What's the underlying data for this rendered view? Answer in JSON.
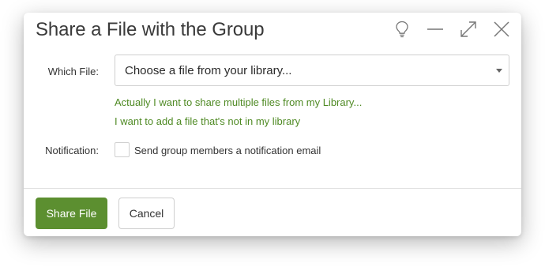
{
  "dialog": {
    "title": "Share a File with the Group",
    "header_icons": [
      "lightbulb-icon",
      "minimize-icon",
      "expand-icon",
      "close-icon"
    ]
  },
  "form": {
    "which_file_label": "Which File:",
    "file_select_value": "Choose a file from your library...",
    "link_multiple": "Actually I want to share multiple files from my Library...",
    "link_not_in_library": "I want to add a file that's not in my library",
    "notification_label": "Notification:",
    "notification_checkbox_label": "Send group members a notification email",
    "notification_checked": false
  },
  "footer": {
    "share_button": "Share File",
    "cancel_button": "Cancel"
  },
  "colors": {
    "accent_green": "#5c8f30",
    "link_green": "#4f8a24"
  }
}
